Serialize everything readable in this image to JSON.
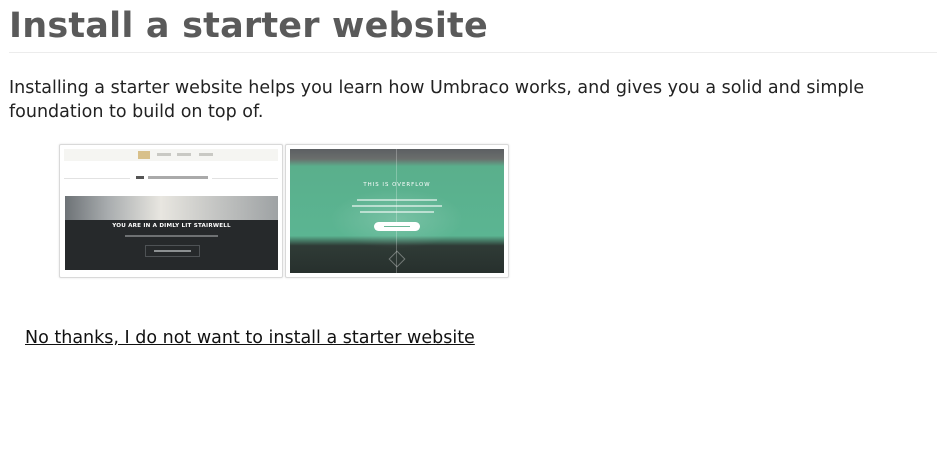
{
  "page": {
    "title": "Install a starter website",
    "intro": "Installing a starter website helps you learn how Umbraco works, and gives you a solid and simple foundation to build on top of."
  },
  "starters": [
    {
      "id": "txt",
      "preview": {
        "headline": "YOU ARE IN A DIMLY LIT STAIRWELL"
      }
    },
    {
      "id": "overflow",
      "preview": {
        "headline": "THIS IS OVERFLOW"
      }
    }
  ],
  "decline_link": "No thanks, I do not want to install a starter website",
  "colors": {
    "title": "#5a5a5a",
    "txt_accent": "#d8c08a",
    "overflow_green": "#5bb592"
  }
}
